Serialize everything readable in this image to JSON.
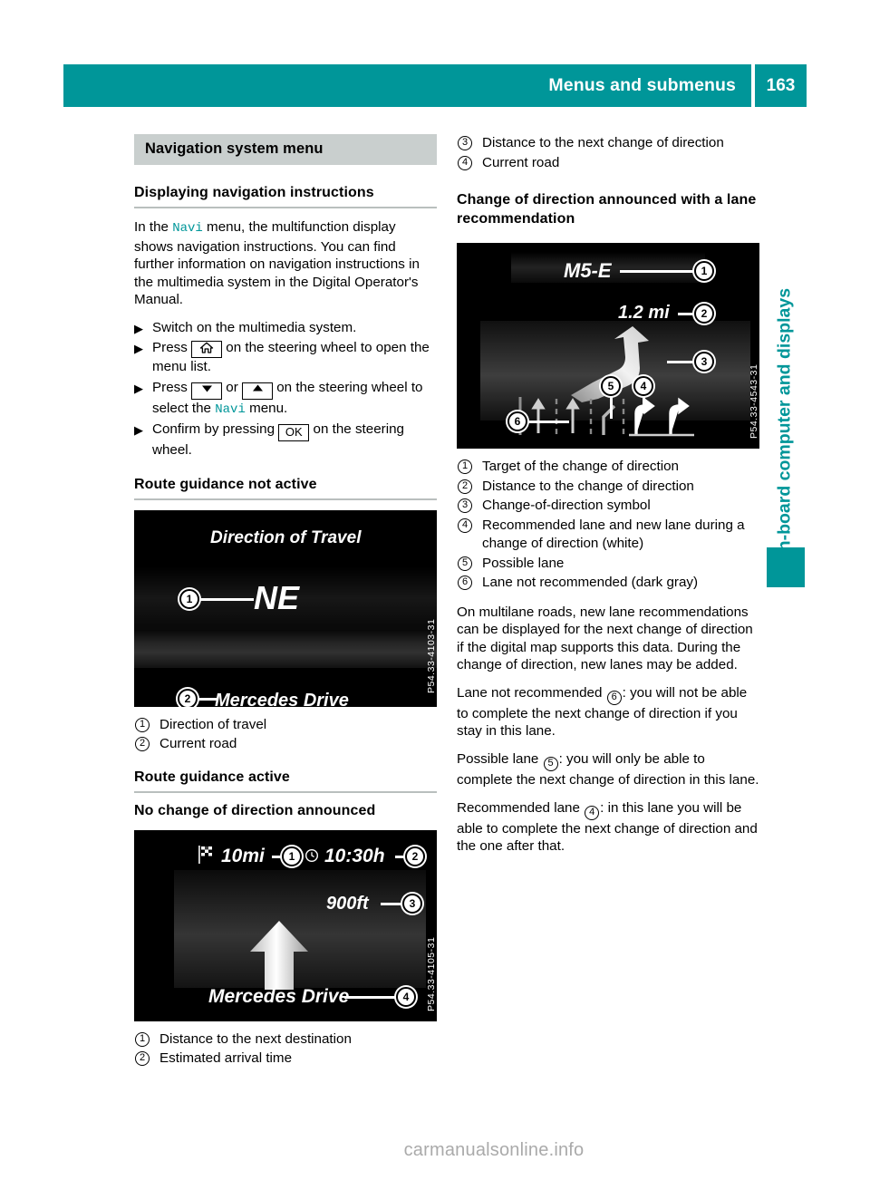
{
  "header": {
    "title": "Menus and submenus",
    "page_number": "163",
    "accent_color": "#009699"
  },
  "side_tab": {
    "label": "On-board computer and displays",
    "color": "#009699"
  },
  "left_column": {
    "section_bar": {
      "title": "Navigation system menu",
      "background": "#c9cfce"
    },
    "sub_head": "Displaying navigation instructions",
    "intro_parts": {
      "p1_a": "In the ",
      "p1_kw": "Navi",
      "p1_b": " menu, the multifunction display shows navigation instructions. You can find further information on navigation instructions in the multimedia system in the Digital Operator's Manual."
    },
    "steps": [
      {
        "bullet": "▶",
        "text_a": "Switch on the multimedia system.",
        "key": null,
        "text_b": ""
      },
      {
        "bullet": "▶",
        "text_a": "Press ",
        "key": "home-icon",
        "text_b": " on the steering wheel to open the menu list."
      },
      {
        "bullet": "▶",
        "text_a": "Press ",
        "key": "down-up-icons",
        "text_b": " on the steering wheel to select the Navi menu."
      },
      {
        "bullet": "▶",
        "text_a": "Confirm by pressing ",
        "key": "OK",
        "text_b": " on the steering wheel."
      }
    ],
    "step2_keylabel": "home",
    "step3_or": " or ",
    "step3_kw": "Navi",
    "step3_tail_a": " on the steering wheel to select the ",
    "step3_tail_b": " menu.",
    "step4_key": "OK",
    "head_not_active": "Route guidance not active",
    "figure_not_active": {
      "caption": "P54.33-4103-31",
      "title_text": "Direction of Travel",
      "direction_text": "NE",
      "road_text": "Mercedes Drive",
      "callouts": [
        "1",
        "2"
      ]
    },
    "legend_not_active": [
      {
        "num": "1",
        "text": "Direction of travel"
      },
      {
        "num": "2",
        "text": "Current road"
      }
    ],
    "head_active": "Route guidance active",
    "head_no_change": "No change of direction announced",
    "figure_no_change": {
      "caption": "P54.33-4105-31",
      "distance_text": "10mi",
      "time_text": "10:30h",
      "next_turn_text": "900ft",
      "road_text": "Mercedes Drive",
      "callouts": [
        "1",
        "2",
        "3",
        "4"
      ]
    },
    "legend_no_change": [
      {
        "num": "1",
        "text": "Distance to the next destination"
      },
      {
        "num": "2",
        "text": "Estimated arrival time"
      }
    ]
  },
  "right_column": {
    "legend_top": [
      {
        "num": "3",
        "text": "Distance to the next change of direction"
      },
      {
        "num": "4",
        "text": "Current road"
      }
    ],
    "head_lane": "Change of direction announced with a lane recommendation",
    "figure_lane": {
      "caption": "P54.33-4543-31",
      "target_text": "M5-E",
      "distance_text": "1.2 mi",
      "callouts": [
        "1",
        "2",
        "3",
        "4",
        "5",
        "6"
      ]
    },
    "legend_lane": [
      {
        "num": "1",
        "text": "Target of the change of direction"
      },
      {
        "num": "2",
        "text": "Distance to the change of direction"
      },
      {
        "num": "3",
        "text": "Change-of-direction symbol"
      },
      {
        "num": "4",
        "text": "Recommended lane and new lane during a change of direction (white)"
      },
      {
        "num": "5",
        "text": "Possible lane"
      },
      {
        "num": "6",
        "text": "Lane not recommended (dark gray)"
      }
    ],
    "para_multilane": "On multilane roads, new lane recommendations can be displayed for the next change of direction if the digital map supports this data. During the change of direction, new lanes may be added.",
    "para_not_recommended_a": "Lane not recommended ",
    "para_not_recommended_num": "6",
    "para_not_recommended_b": ": you will not be able to complete the next change of direction if you stay in this lane.",
    "para_possible_a": "Possible lane ",
    "para_possible_num": "5",
    "para_possible_b": ": you will only be able to complete the next change of direction in this lane.",
    "para_recommended_a": "Recommended lane ",
    "para_recommended_num": "4",
    "para_recommended_b": ": in this lane you will be able to complete the next change of direction and the one after that."
  },
  "watermark": "carmanualsonline.info"
}
